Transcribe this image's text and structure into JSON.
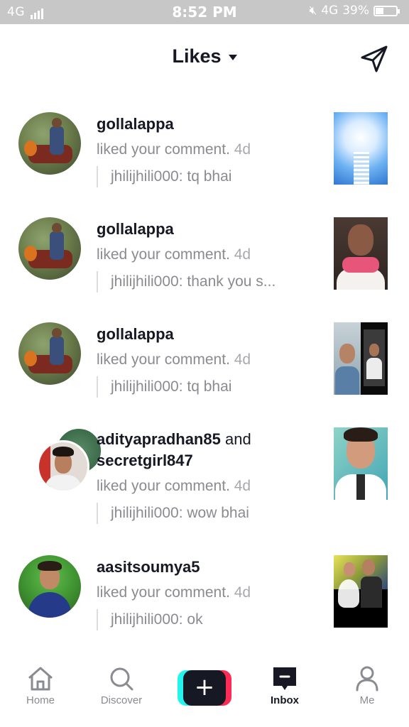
{
  "status_bar": {
    "network_left": "4G",
    "time": "8:52 PM",
    "network_right": "4G",
    "battery_percent": "39%",
    "battery_level": 0.39
  },
  "header": {
    "title": "Likes",
    "send_icon": "paper-plane-icon"
  },
  "notifications": [
    {
      "users": [
        "gollalappa"
      ],
      "connector": "",
      "action": "liked your comment.",
      "time": "4d",
      "comment": "jhilijhili000: tq bhai"
    },
    {
      "users": [
        "gollalappa"
      ],
      "connector": "",
      "action": "liked your comment.",
      "time": "4d",
      "comment": "jhilijhili000: thank you s..."
    },
    {
      "users": [
        "gollalappa"
      ],
      "connector": "",
      "action": "liked your comment.",
      "time": "4d",
      "comment": "jhilijhili000: tq bhai"
    },
    {
      "users": [
        "adityapradhan85",
        "secretgirl847"
      ],
      "connector": "and",
      "action": "liked your comment.",
      "time": "4d",
      "comment": "jhilijhili000: wow bhai"
    },
    {
      "users": [
        "aasitsoumya5"
      ],
      "connector": "",
      "action": "liked your comment.",
      "time": "4d",
      "comment": "jhilijhili000: ok"
    }
  ],
  "bottom_nav": {
    "items": [
      {
        "label": "Home",
        "icon": "home-icon"
      },
      {
        "label": "Discover",
        "icon": "search-icon"
      },
      {
        "label": "",
        "icon": "plus-icon"
      },
      {
        "label": "Inbox",
        "icon": "inbox-icon",
        "active": true
      },
      {
        "label": "Me",
        "icon": "person-icon"
      }
    ]
  },
  "colors": {
    "text_primary": "#161823",
    "text_secondary": "#8a8b91",
    "accent_cyan": "#25f4ee",
    "accent_red": "#fe2c55"
  }
}
